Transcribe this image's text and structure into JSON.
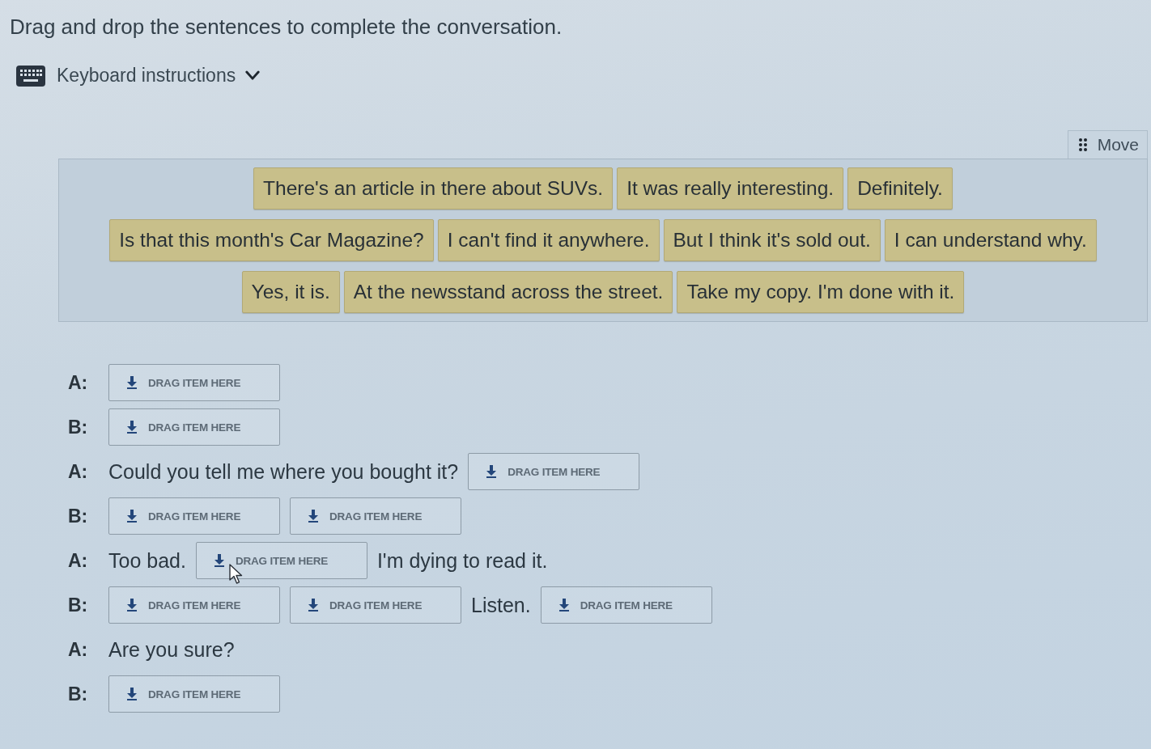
{
  "instruction": "Drag and drop the sentences to complete the conversation.",
  "keyboard_instructions": {
    "label": "Keyboard instructions",
    "expanded": false
  },
  "bank": {
    "move_label": "Move",
    "tile_rows": [
      [
        "There's an article in there about SUVs.",
        "It was really interesting.",
        "Definitely."
      ],
      [
        "Is that this month's Car Magazine?",
        "I can't find it anywhere.",
        "But I think it's sold out.",
        "I can understand why."
      ],
      [
        "Yes, it is.",
        "At the newsstand across the street.",
        "Take my copy. I'm done with it."
      ]
    ]
  },
  "dialogue": [
    {
      "speaker": "A:",
      "parts": [
        {
          "kind": "drop",
          "placeholder": "DRAG ITEM HERE"
        }
      ]
    },
    {
      "speaker": "B:",
      "parts": [
        {
          "kind": "drop",
          "placeholder": "DRAG ITEM HERE"
        }
      ]
    },
    {
      "speaker": "A:",
      "parts": [
        {
          "kind": "text",
          "text": "Could you tell me where you bought it?"
        },
        {
          "kind": "drop",
          "placeholder": "DRAG ITEM HERE"
        }
      ]
    },
    {
      "speaker": "B:",
      "parts": [
        {
          "kind": "drop",
          "placeholder": "DRAG ITEM HERE"
        },
        {
          "kind": "drop",
          "placeholder": "DRAG ITEM HERE"
        }
      ]
    },
    {
      "speaker": "A:",
      "parts": [
        {
          "kind": "text",
          "text": "Too bad."
        },
        {
          "kind": "drop",
          "placeholder": "DRAG ITEM HERE"
        },
        {
          "kind": "text",
          "text": "I'm dying to read it."
        }
      ]
    },
    {
      "speaker": "B:",
      "parts": [
        {
          "kind": "drop",
          "placeholder": "DRAG ITEM HERE"
        },
        {
          "kind": "drop",
          "placeholder": "DRAG ITEM HERE"
        },
        {
          "kind": "text",
          "text": "Listen."
        },
        {
          "kind": "drop",
          "placeholder": "DRAG ITEM HERE"
        }
      ]
    },
    {
      "speaker": "A:",
      "parts": [
        {
          "kind": "text",
          "text": "Are you sure?"
        }
      ]
    },
    {
      "speaker": "B:",
      "parts": [
        {
          "kind": "drop",
          "placeholder": "DRAG ITEM HERE"
        }
      ]
    }
  ]
}
